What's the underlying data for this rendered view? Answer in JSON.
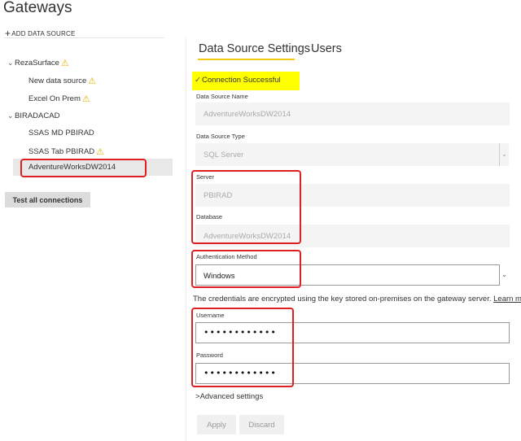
{
  "page": {
    "title": "Gateways"
  },
  "sidebar": {
    "add_data_source": "ADD DATA SOURCE",
    "tree": [
      {
        "label": "RezaSurface",
        "warning": true,
        "expanded": true,
        "children": [
          {
            "label": "New data source",
            "warning": true
          },
          {
            "label": "Excel On Prem",
            "warning": true
          }
        ]
      },
      {
        "label": "BIRADACAD",
        "warning": false,
        "expanded": true,
        "children": [
          {
            "label": "SSAS MD PBIRAD",
            "warning": false
          },
          {
            "label": "SSAS Tab PBIRAD",
            "warning": true
          },
          {
            "label": "AdventureWorksDW2014",
            "warning": false,
            "selected": true
          }
        ]
      }
    ],
    "test_all": "Test all connections"
  },
  "tabs": [
    {
      "label": "Data Source Settings",
      "active": true
    },
    {
      "label": "Users",
      "active": false
    }
  ],
  "status": {
    "message": "Connection Successful",
    "highlight_color": "#ffff00"
  },
  "form": {
    "ds_name": {
      "label": "Data Source Name",
      "value": "AdventureWorksDW2014"
    },
    "ds_type": {
      "label": "Data Source Type",
      "value": "SQL Server"
    },
    "server": {
      "label": "Server",
      "value": "PBIRAD"
    },
    "database": {
      "label": "Database",
      "value": "AdventureWorksDW2014"
    },
    "auth": {
      "label": "Authentication Method",
      "value": "Windows"
    },
    "credentials_note": "The credentials are encrypted using the key stored on-premises on the gateway server.",
    "learn_more": "Learn more",
    "username": {
      "label": "Username",
      "value": "••••••••••••"
    },
    "password": {
      "label": "Password",
      "value": "••••••••••••"
    },
    "advanced": "Advanced settings",
    "apply": "Apply",
    "discard": "Discard"
  },
  "icons": {
    "plus": "plus-icon",
    "chevron": "chevron-down-icon",
    "warning": "warning-icon",
    "check": "checkmark-icon",
    "caret": "dropdown-caret-icon",
    "chevron_right": "chevron-right-icon"
  },
  "colors": {
    "accent_underline": "#f2c811",
    "warning": "#e6b000",
    "annotation_red": "#e02020",
    "selected_row": "#e8e8e8"
  }
}
